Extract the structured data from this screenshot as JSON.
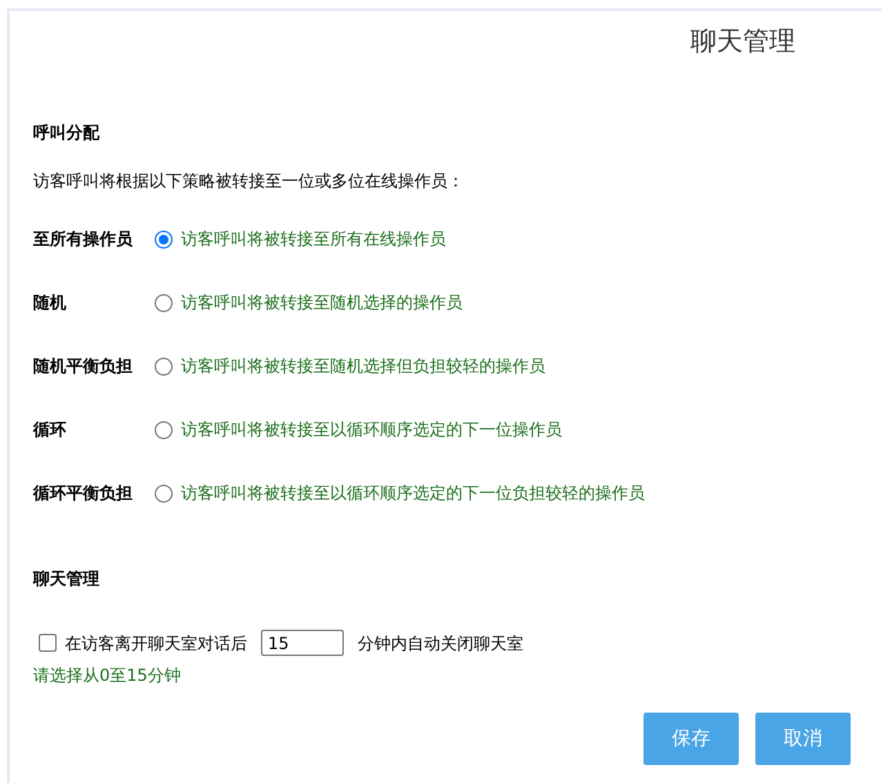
{
  "title": "聊天管理",
  "distribution": {
    "heading": "呼叫分配",
    "intro": "访客呼叫将根据以下策略被转接至一位或多位在线操作员：",
    "options": [
      {
        "label": "至所有操作员",
        "description": "访客呼叫将被转接至所有在线操作员",
        "selected": true
      },
      {
        "label": "随机",
        "description": "访客呼叫将被转接至随机选择的操作员",
        "selected": false
      },
      {
        "label": "随机平衡负担",
        "description": "访客呼叫将被转接至随机选择但负担较轻的操作员",
        "selected": false
      },
      {
        "label": "循环",
        "description": "访客呼叫将被转接至以循环顺序选定的下一位操作员",
        "selected": false
      },
      {
        "label": "循环平衡负担",
        "description": "访客呼叫将被转接至以循环顺序选定的下一位负担较轻的操作员",
        "selected": false
      }
    ]
  },
  "chat_management": {
    "heading": "聊天管理",
    "auto_close": {
      "checked": false,
      "label_before": "在访客离开聊天室对话后",
      "minutes": "15",
      "label_after": "分钟内自动关闭聊天室"
    },
    "hint": "请选择从0至15分钟"
  },
  "buttons": [
    {
      "label": "保存"
    },
    {
      "label": "取消"
    }
  ]
}
